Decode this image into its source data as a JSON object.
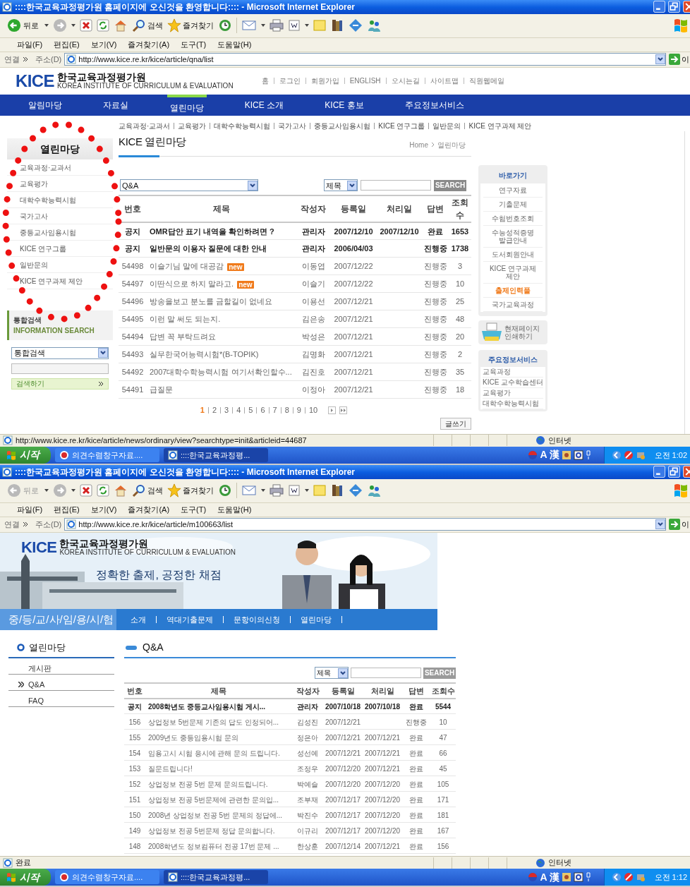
{
  "screens": [
    {
      "window": {
        "title": "::::한국교육과정평가원 홈페이지에 오신것을 환영합니다:::: - Microsoft Internet Explorer"
      },
      "toolbar": {
        "back": "뒤로",
        "back_disabled": false,
        "search": "검색",
        "favorites": "즐겨찾기"
      },
      "menu": [
        "파일(F)",
        "편집(E)",
        "보기(V)",
        "즐겨찾기(A)",
        "도구(T)",
        "도움말(H)"
      ],
      "address": {
        "links": "연결",
        "label": "주소(D)",
        "url": "http://www.kice.re.kr/kice/article/qna/list",
        "go": "이"
      },
      "page": {
        "kind": "portal",
        "logo": {
          "mark": "KICE",
          "name": "한국교육과정평가원",
          "tagline": "KOREA INSTITUTE OF CURRICULUM & EVALUATION"
        },
        "utility_links": [
          "홈",
          "로그인",
          "회원가입",
          "ENGLISH",
          "오시는길",
          "사이트맵",
          "직원웹메일"
        ],
        "nav": [
          {
            "label": "알림마당",
            "selected": false
          },
          {
            "label": "자료실",
            "selected": false
          },
          {
            "label": "열린마당",
            "selected": true
          },
          {
            "label": "KICE 소개",
            "selected": false
          },
          {
            "label": "KICE 홍보",
            "selected": false
          },
          {
            "label": "주요정보서비스",
            "selected": false
          }
        ],
        "sub_nav": [
          "교육과정·교과서",
          "교육평가",
          "대학수학능력시험",
          "국가고사",
          "중등교사임용시험",
          "KICE 연구그룹",
          "일반문의",
          "KICE 연구과제 제안"
        ],
        "sidebar": {
          "title": "열린마당",
          "items": [
            "교육과정·교과서",
            "교육평가",
            "대학수학능력시험",
            "국가고사",
            "중등교사임용시험",
            "KICE 연구그룹",
            "일반문의",
            "KICE 연구과제 제안"
          ],
          "search": {
            "title": "통합검색",
            "subtitle": "INFORMATION SEARCH",
            "scope": "통합검색",
            "button": "검색하기"
          }
        },
        "heading": "KICE 열린마당",
        "breadcrumb": [
          "Home",
          "열린마당"
        ],
        "board": {
          "category": "Q&A",
          "field": "제목",
          "search_button": "SEARCH",
          "columns": [
            "번호",
            "제목",
            "작성자",
            "등록일",
            "처리일",
            "답변",
            "조회수"
          ],
          "rows": [
            {
              "notice": true,
              "number": "공지",
              "title": "OMR답안 표기 내역을 확인하려면 ?",
              "author": "관리자",
              "registered": "2007/12/10",
              "processed": "2007/12/10",
              "answer": "완료",
              "views": "1653"
            },
            {
              "notice": true,
              "number": "공지",
              "title": "일반문의 이용자 질문에 대한 안내",
              "author": "관리자",
              "registered": "2006/04/03",
              "answer": "진행중",
              "views": "1738"
            },
            {
              "notice": false,
              "number": "54498",
              "title": "이슬기님 말에 대공감",
              "badge": "new",
              "author": "이동엽",
              "registered": "2007/12/22",
              "answer": "진행중",
              "views": "3"
            },
            {
              "notice": false,
              "number": "54497",
              "title": "이딴식으로 하지 말라고.",
              "badge": "new",
              "author": "이슬기",
              "registered": "2007/12/22",
              "answer": "진행중",
              "views": "10"
            },
            {
              "notice": false,
              "number": "54496",
              "title": "방송을보고 분노를 금할길이 없네요",
              "author": "이용선",
              "registered": "2007/12/21",
              "answer": "진행중",
              "views": "25"
            },
            {
              "notice": false,
              "number": "54495",
              "title": "이런 말 써도 되는지.",
              "author": "김은송",
              "registered": "2007/12/21",
              "answer": "진행중",
              "views": "48"
            },
            {
              "notice": false,
              "number": "54494",
              "title": "답변 꼭 부탁드려요",
              "author": "박성은",
              "registered": "2007/12/21",
              "answer": "진행중",
              "views": "20"
            },
            {
              "notice": false,
              "number": "54493",
              "title": "실무한국어능력시험*(B-TOPIK)",
              "author": "김명화",
              "registered": "2007/12/21",
              "answer": "진행중",
              "views": "2"
            },
            {
              "notice": false,
              "number": "54492",
              "title": "2007대학수학능력시험 여기서확인할수...",
              "author": "김진호",
              "registered": "2007/12/21",
              "answer": "진행중",
              "views": "35"
            },
            {
              "notice": false,
              "number": "54491",
              "title": "급질문",
              "author": "이정아",
              "registered": "2007/12/21",
              "answer": "진행중",
              "views": "18"
            }
          ],
          "pages": [
            {
              "label": "1",
              "selected": true
            },
            {
              "label": "2",
              "selected": false
            },
            {
              "label": "3",
              "selected": false
            },
            {
              "label": "4",
              "selected": false
            },
            {
              "label": "5",
              "selected": false
            },
            {
              "label": "6",
              "selected": false
            },
            {
              "label": "7",
              "selected": false
            },
            {
              "label": "8",
              "selected": false
            },
            {
              "label": "9",
              "selected": false
            },
            {
              "label": "10",
              "selected": false
            }
          ],
          "write_button": "글쓰기"
        },
        "quick_links": {
          "title": "바로가기",
          "items": [
            {
              "label": "연구자료",
              "highlighted": false
            },
            {
              "label": "기출문제",
              "highlighted": false
            },
            {
              "label": "수험번호조회",
              "highlighted": false
            },
            {
              "label": "수능성적증명 발급안내",
              "highlighted": false
            },
            {
              "label": "도서회원안내",
              "highlighted": false
            },
            {
              "label": "KICE 연구과제 제안",
              "highlighted": false
            },
            {
              "label": "출제인력풀",
              "highlighted": true
            },
            {
              "label": "국가교육과정",
              "highlighted": false
            }
          ]
        },
        "print": "현재페이지 인쇄하기",
        "services": {
          "title": "주요정보서비스",
          "items": [
            "교육과정",
            "KICE 교수학습센터",
            "교육평가",
            "대학수학능력시험"
          ]
        }
      },
      "status_bar": {
        "text": "http://www.kice.re.kr/kice/article/news/ordinary/view?searchtype=init&articleid=44687",
        "zone": "인터넷"
      },
      "taskbar": {
        "start": "시작",
        "tasks": [
          {
            "label": "의견수렴창구자료....",
            "selected": false
          },
          {
            "label": "::::한국교육과정평...",
            "selected": true
          }
        ],
        "ime": [
          "A",
          "漢"
        ],
        "clock": "오전 1:02"
      }
    },
    {
      "window": {
        "title": "::::한국교육과정평가원 홈페이지에 오신것을 환영합니다:::: - Microsoft Internet Explorer"
      },
      "toolbar": {
        "back": "뒤로",
        "back_disabled": true,
        "search": "검색",
        "favorites": "즐겨찾기"
      },
      "menu": [
        "파일(F)",
        "편집(E)",
        "보기(V)",
        "즐겨찾기(A)",
        "도구(T)",
        "도움말(H)"
      ],
      "address": {
        "links": "연결",
        "label": "주소(D)",
        "url": "http://www.kice.re.kr/kice/article/m100663/list",
        "go": "이"
      },
      "page": {
        "kind": "exam",
        "logo": {
          "mark": "KICE",
          "name": "한국교육과정평가원",
          "tagline": "KOREA INSTITUTE OF CURRICULUM & EVALUATION"
        },
        "slogan": "정확한 출제, 공정한 채점",
        "section_title": "중/등/교/사/임/용/시/험",
        "nav": [
          "소개",
          "역대기출문제",
          "문항이의신청",
          "열린마당"
        ],
        "sidebar": {
          "title": "열린마당",
          "items": [
            {
              "label": "게시판",
              "selected": false
            },
            {
              "label": "Q&A",
              "selected": true
            },
            {
              "label": "FAQ",
              "selected": false
            }
          ]
        },
        "heading": "Q&A",
        "board": {
          "field": "제목",
          "search_button": "SEARCH",
          "columns": [
            "번호",
            "제목",
            "작성자",
            "등록일",
            "처리일",
            "답변",
            "조회수"
          ],
          "rows": [
            {
              "notice": true,
              "number": "공지",
              "title": "2008학년도 중등교사임용시험 게시...",
              "author": "관리자",
              "registered": "2007/10/18",
              "processed": "2007/10/18",
              "answer": "완료",
              "views": "5544"
            },
            {
              "notice": false,
              "number": "156",
              "title": "상업정보 5번문제 기존의 답도 인정되어...",
              "author": "김성진",
              "registered": "2007/12/21",
              "answer": "진행중",
              "views": "10"
            },
            {
              "notice": false,
              "number": "155",
              "title": "2009년도 중등임용시험 문의",
              "author": "정은아",
              "registered": "2007/12/21",
              "processed": "2007/12/21",
              "answer": "완료",
              "views": "47"
            },
            {
              "notice": false,
              "number": "154",
              "title": "임용고시 시험 응시에 관해 문의 드립니다.",
              "author": "성선예",
              "registered": "2007/12/21",
              "processed": "2007/12/21",
              "answer": "완료",
              "views": "66"
            },
            {
              "notice": false,
              "number": "153",
              "title": "질문드립니다!",
              "author": "조정우",
              "registered": "2007/12/20",
              "processed": "2007/12/21",
              "answer": "완료",
              "views": "45"
            },
            {
              "notice": false,
              "number": "152",
              "title": "상업정보 전공 5번 문제 문의드립니다.",
              "author": "박예슬",
              "registered": "2007/12/20",
              "processed": "2007/12/20",
              "answer": "완료",
              "views": "105"
            },
            {
              "notice": false,
              "number": "151",
              "title": "상업정보 전공 5번문제에 관련한 문의입...",
              "author": "조부재",
              "registered": "2007/12/17",
              "processed": "2007/12/20",
              "answer": "완료",
              "views": "171"
            },
            {
              "notice": false,
              "number": "150",
              "title": "2008년 상업정보 전공 5번 문제의 정답에...",
              "author": "박진수",
              "registered": "2007/12/17",
              "processed": "2007/12/20",
              "answer": "완료",
              "views": "181"
            },
            {
              "notice": false,
              "number": "149",
              "title": "상업정보 전공 5번문제 정답 문의합니다.",
              "author": "이규리",
              "registered": "2007/12/17",
              "processed": "2007/12/20",
              "answer": "완료",
              "views": "167"
            },
            {
              "notice": false,
              "number": "148",
              "title": "2008학년도 정보컴퓨터 전공 17번 문제 ...",
              "author": "한상훈",
              "registered": "2007/12/14",
              "processed": "2007/12/21",
              "answer": "완료",
              "views": "156"
            }
          ]
        }
      },
      "status_bar": {
        "text": "완료",
        "zone": "인터넷"
      },
      "taskbar": {
        "start": "시작",
        "tasks": [
          {
            "label": "의견수렴창구자료....",
            "selected": false
          },
          {
            "label": "::::한국교육과정평...",
            "selected": true
          }
        ],
        "ime": [
          "A",
          "漢"
        ],
        "clock": "오전 1:12"
      }
    }
  ]
}
